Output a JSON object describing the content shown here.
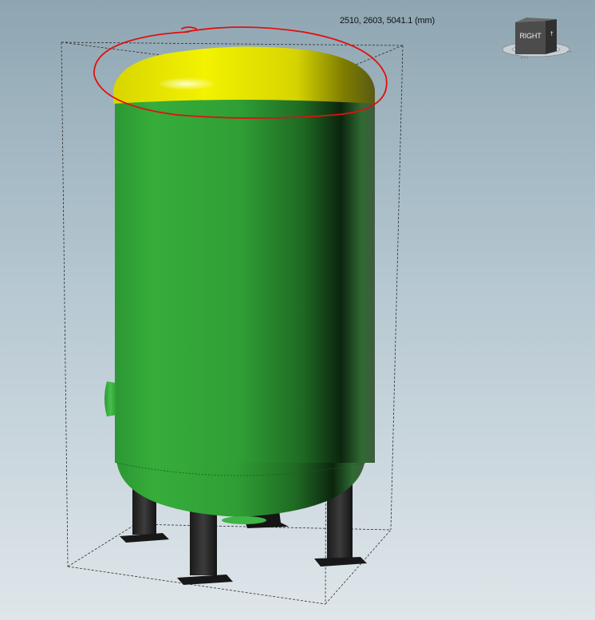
{
  "viewport": {
    "dimension_readout": "2510, 2603, 5041.1 (mm)"
  },
  "view_cube": {
    "face_label": "RIGHT"
  },
  "colors": {
    "background_top": "#8ea6b2",
    "background_bottom": "#dfe6ea",
    "tank_body": "#33a63a",
    "tank_head": "#e2e000",
    "support_legs": "#2a2a2a",
    "annotation": "#e01010"
  }
}
